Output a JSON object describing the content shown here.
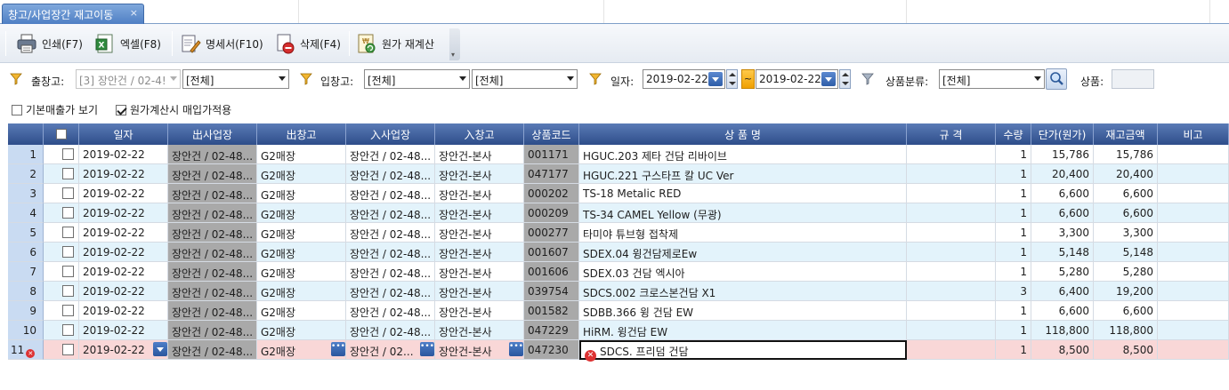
{
  "tab": {
    "title": "창고/사업장간 재고이동",
    "close": "×"
  },
  "toolbar": {
    "print": "인쇄(F7)",
    "excel": "엑셀(F8)",
    "statement": "명세서(F10)",
    "delete": "삭제(F4)",
    "recalc": "원가 재계산"
  },
  "filters": {
    "out_warehouse_label": "출창고:",
    "out_site_value": "[3] 장안건 / 02-4!",
    "out_warehouse_value": "[전체]",
    "in_warehouse_label": "입창고:",
    "in_site_value": "[전체]",
    "in_warehouse_value": "[전체]",
    "date_label": "일자:",
    "date_from": "2019-02-22",
    "date_sep": "~",
    "date_to": "2019-02-22",
    "category_label": "상품분류:",
    "category_value": "[전체]",
    "product_label": "상품:",
    "product_value": ""
  },
  "options": {
    "show_base_sales": {
      "label": "기본매출가 보기",
      "checked": false
    },
    "apply_purchase_price": {
      "label": "원가계산시 매입가적용",
      "checked": true
    }
  },
  "grid": {
    "columns": [
      "",
      "",
      "일자",
      "出사업장",
      "出창고",
      "入사업장",
      "入창고",
      "상품코드",
      "상 품 명",
      "규 격",
      "수량",
      "단가(원가)",
      "재고금액",
      "비고"
    ],
    "rows": [
      {
        "no": "1",
        "date": "2019-02-22",
        "out_site": "장안건 / 02-48...",
        "out_wh": "G2매장",
        "in_site": "장안건 / 02-48...",
        "in_wh": "장안건-본사",
        "code": "001171",
        "name": "HGUC.203 제타 건담 리바이브",
        "spec": "",
        "qty": "1",
        "price": "15,786",
        "amount": "15,786",
        "note": ""
      },
      {
        "no": "2",
        "date": "2019-02-22",
        "out_site": "장안건 / 02-48...",
        "out_wh": "G2매장",
        "in_site": "장안건 / 02-48...",
        "in_wh": "장안건-본사",
        "code": "047177",
        "name": "HGUC.221 구스타프 칼 UC Ver",
        "spec": "",
        "qty": "1",
        "price": "20,400",
        "amount": "20,400",
        "note": ""
      },
      {
        "no": "3",
        "date": "2019-02-22",
        "out_site": "장안건 / 02-48...",
        "out_wh": "G2매장",
        "in_site": "장안건 / 02-48...",
        "in_wh": "장안건-본사",
        "code": "000202",
        "name": "TS-18 Metalic RED",
        "spec": "",
        "qty": "1",
        "price": "6,600",
        "amount": "6,600",
        "note": ""
      },
      {
        "no": "4",
        "date": "2019-02-22",
        "out_site": "장안건 / 02-48...",
        "out_wh": "G2매장",
        "in_site": "장안건 / 02-48...",
        "in_wh": "장안건-본사",
        "code": "000209",
        "name": "TS-34 CAMEL Yellow (무광)",
        "spec": "",
        "qty": "1",
        "price": "6,600",
        "amount": "6,600",
        "note": ""
      },
      {
        "no": "5",
        "date": "2019-02-22",
        "out_site": "장안건 / 02-48...",
        "out_wh": "G2매장",
        "in_site": "장안건 / 02-48...",
        "in_wh": "장안건-본사",
        "code": "000277",
        "name": "타미야 튜브형 접착제",
        "spec": "",
        "qty": "1",
        "price": "3,300",
        "amount": "3,300",
        "note": ""
      },
      {
        "no": "6",
        "date": "2019-02-22",
        "out_site": "장안건 / 02-48...",
        "out_wh": "G2매장",
        "in_site": "장안건 / 02-48...",
        "in_wh": "장안건-본사",
        "code": "001607",
        "name": "SDEX.04 윙건담제로Ew",
        "spec": "",
        "qty": "1",
        "price": "5,148",
        "amount": "5,148",
        "note": ""
      },
      {
        "no": "7",
        "date": "2019-02-22",
        "out_site": "장안건 / 02-48...",
        "out_wh": "G2매장",
        "in_site": "장안건 / 02-48...",
        "in_wh": "장안건-본사",
        "code": "001606",
        "name": "SDEX.03 건담 엑시아",
        "spec": "",
        "qty": "1",
        "price": "5,280",
        "amount": "5,280",
        "note": ""
      },
      {
        "no": "8",
        "date": "2019-02-22",
        "out_site": "장안건 / 02-48...",
        "out_wh": "G2매장",
        "in_site": "장안건 / 02-48...",
        "in_wh": "장안건-본사",
        "code": "039754",
        "name": "SDCS.002 크로스본건담 X1",
        "spec": "",
        "qty": "3",
        "price": "6,400",
        "amount": "19,200",
        "note": ""
      },
      {
        "no": "9",
        "date": "2019-02-22",
        "out_site": "장안건 / 02-48...",
        "out_wh": "G2매장",
        "in_site": "장안건 / 02-48...",
        "in_wh": "장안건-본사",
        "code": "001582",
        "name": "SDBB.366 윙 건담 EW",
        "spec": "",
        "qty": "1",
        "price": "6,600",
        "amount": "6,600",
        "note": ""
      },
      {
        "no": "10",
        "date": "2019-02-22",
        "out_site": "장안건 / 02-48...",
        "out_wh": "G2매장",
        "in_site": "장안건 / 02-48...",
        "in_wh": "장안건-본사",
        "code": "047229",
        "name": "HiRM. 윙건담 EW",
        "spec": "",
        "qty": "1",
        "price": "118,800",
        "amount": "118,800",
        "note": ""
      },
      {
        "no": "11",
        "date": "2019-02-22",
        "out_site": "장안건 / 02-48...",
        "out_wh": "G2매장",
        "in_site": "장안건 / 02...",
        "in_wh": "장안건-본사",
        "code": "047230",
        "name": "SDCS. 프리덤 건담",
        "spec": "",
        "qty": "1",
        "price": "8,500",
        "amount": "8,500",
        "note": "",
        "error": true
      }
    ]
  },
  "colors": {
    "header_top": "#5a7bb6",
    "header_bottom": "#2e4d8a",
    "row_alt": "#e3f3fb",
    "row_error": "#f9d7d7",
    "locked_cell": "#a9a9a9",
    "rownum": "#c9dbf2"
  }
}
